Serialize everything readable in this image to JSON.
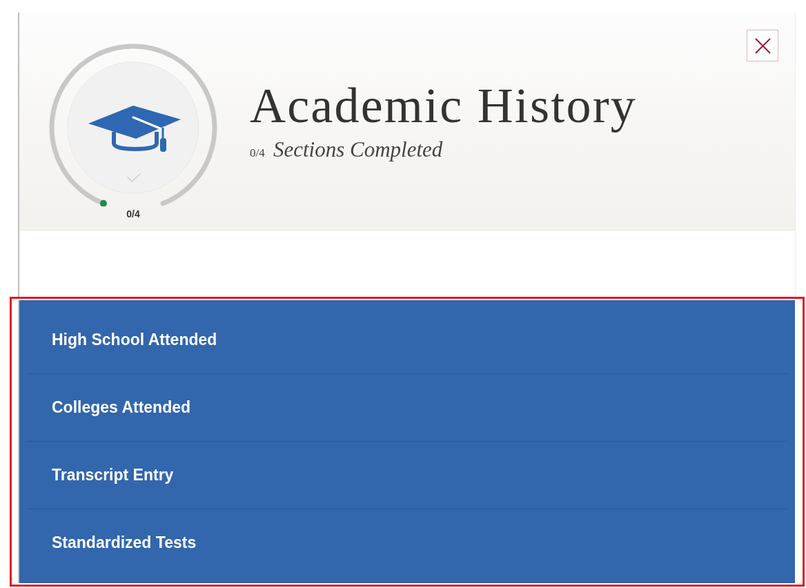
{
  "progress": {
    "count": "0/4",
    "level": 0,
    "complete": false
  },
  "header": {
    "title": "Academic History",
    "subtitle": "0/4 *Sections Completed*"
  },
  "sections": [
    {
      "label": "High School Attended"
    },
    {
      "label": "Colleges Attended"
    },
    {
      "label": "Transcript Entry"
    },
    {
      "label": "Standardized Tests"
    }
  ]
}
